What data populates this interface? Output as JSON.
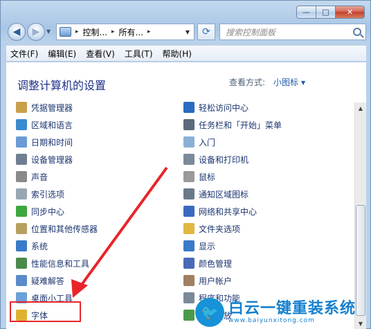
{
  "window": {
    "minimize_glyph": "—",
    "maximize_glyph": "□",
    "close_glyph": "✕"
  },
  "nav": {
    "back_glyph": "◀",
    "forward_glyph": "▶",
    "breadcrumb": [
      "控制...",
      "所有..."
    ],
    "breadcrumb_sep": "▸",
    "search_placeholder": "搜索控制面板"
  },
  "menu": [
    "文件(F)",
    "编辑(E)",
    "查看(V)",
    "工具(T)",
    "帮助(H)"
  ],
  "header": {
    "title": "调整计算机的设置",
    "view_by_label": "查看方式:",
    "view_by_value": "小图标"
  },
  "items_left": [
    {
      "label": "凭据管理器",
      "icon": "credential-manager-icon",
      "color": "#c9a04a"
    },
    {
      "label": "区域和语言",
      "icon": "globe-icon",
      "color": "#3a8ad0"
    },
    {
      "label": "日期和时间",
      "icon": "calendar-clock-icon",
      "color": "#6a9bd4"
    },
    {
      "label": "设备管理器",
      "icon": "device-manager-icon",
      "color": "#6f7f8f"
    },
    {
      "label": "声音",
      "icon": "speaker-icon",
      "color": "#8a8a8a"
    },
    {
      "label": "索引选项",
      "icon": "index-icon",
      "color": "#9aa6b2"
    },
    {
      "label": "同步中心",
      "icon": "sync-icon",
      "color": "#3da83d"
    },
    {
      "label": "位置和其他传感器",
      "icon": "sensor-icon",
      "color": "#b8a060"
    },
    {
      "label": "系统",
      "icon": "system-icon",
      "color": "#3a7ac8"
    },
    {
      "label": "性能信息和工具",
      "icon": "performance-icon",
      "color": "#4a8a4a"
    },
    {
      "label": "疑难解答",
      "icon": "troubleshoot-icon",
      "color": "#5a8ac8"
    },
    {
      "label": "桌面小工具",
      "icon": "gadgets-icon",
      "color": "#6aa0d8"
    },
    {
      "label": "字体",
      "icon": "font-icon",
      "color": "#e0b030"
    }
  ],
  "items_right": [
    {
      "label": "轻松访问中心",
      "icon": "ease-of-access-icon",
      "color": "#2a6ac0"
    },
    {
      "label": "任务栏和「开始」菜单",
      "icon": "taskbar-icon",
      "color": "#5a6a7a"
    },
    {
      "label": "入门",
      "icon": "getting-started-icon",
      "color": "#8ab0d8"
    },
    {
      "label": "设备和打印机",
      "icon": "printer-icon",
      "color": "#7a8a9a"
    },
    {
      "label": "鼠标",
      "icon": "mouse-icon",
      "color": "#9a9a9a"
    },
    {
      "label": "通知区域图标",
      "icon": "notification-area-icon",
      "color": "#6a7a8a"
    },
    {
      "label": "网络和共享中心",
      "icon": "network-icon",
      "color": "#3a6ac0"
    },
    {
      "label": "文件夹选项",
      "icon": "folder-options-icon",
      "color": "#e0b840"
    },
    {
      "label": "显示",
      "icon": "display-icon",
      "color": "#3a7ac8"
    },
    {
      "label": "颜色管理",
      "icon": "color-management-icon",
      "color": "#4a6ab8"
    },
    {
      "label": "用户帐户",
      "icon": "user-accounts-icon",
      "color": "#a08060"
    },
    {
      "label": "程序和功能",
      "icon": "programs-icon",
      "color": "#7a8a9a"
    },
    {
      "label": "自动播放",
      "icon": "autoplay-icon",
      "color": "#4a9a4a"
    }
  ],
  "watermark": {
    "title": "白云一键重装系统",
    "url": "www.baiyunxitong.com"
  }
}
